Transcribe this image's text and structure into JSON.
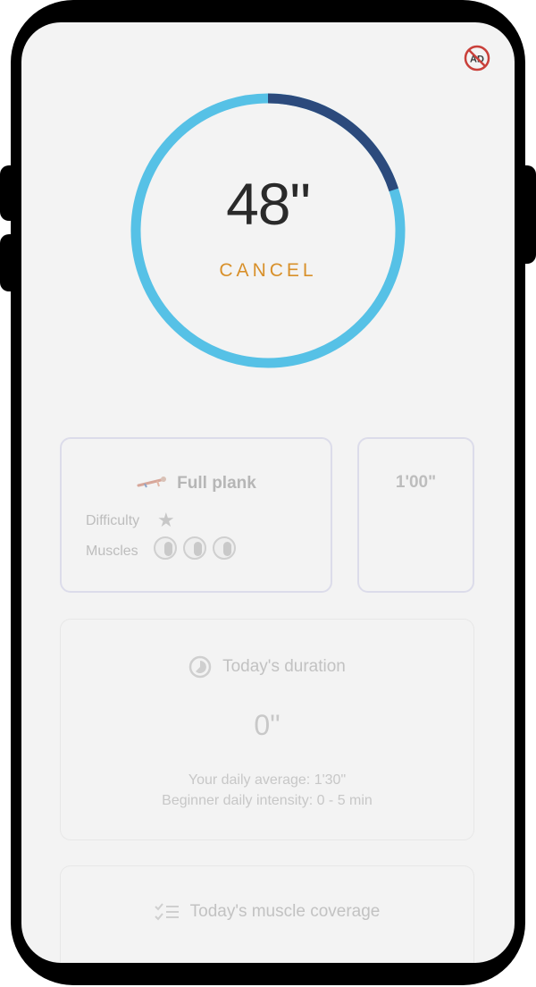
{
  "app": {
    "no_ads_badge": "AD",
    "icons": {
      "no_ads": "no-ads-icon",
      "difficulty": "star-icon",
      "duration": "pie-clock-icon",
      "coverage": "checklist-icon"
    },
    "colors": {
      "ring_remaining": "#56c1e6",
      "ring_elapsed": "#2c4a7c",
      "cancel_text": "#d8902a"
    }
  },
  "timer": {
    "display": "48\"",
    "cancel_label": "CANCEL",
    "progress": 0.2
  },
  "exercise_card": {
    "name": "Full plank",
    "difficulty_label": "Difficulty",
    "difficulty_stars": 1,
    "muscles_label": "Muscles"
  },
  "time_card": {
    "value": "1'00\""
  },
  "duration_card": {
    "title": "Today's duration",
    "value": "0\"",
    "daily_average": "Your daily average: 1'30\"",
    "intensity": "Beginner daily intensity: 0 - 5 min"
  },
  "coverage_card": {
    "title": "Today's muscle coverage"
  }
}
